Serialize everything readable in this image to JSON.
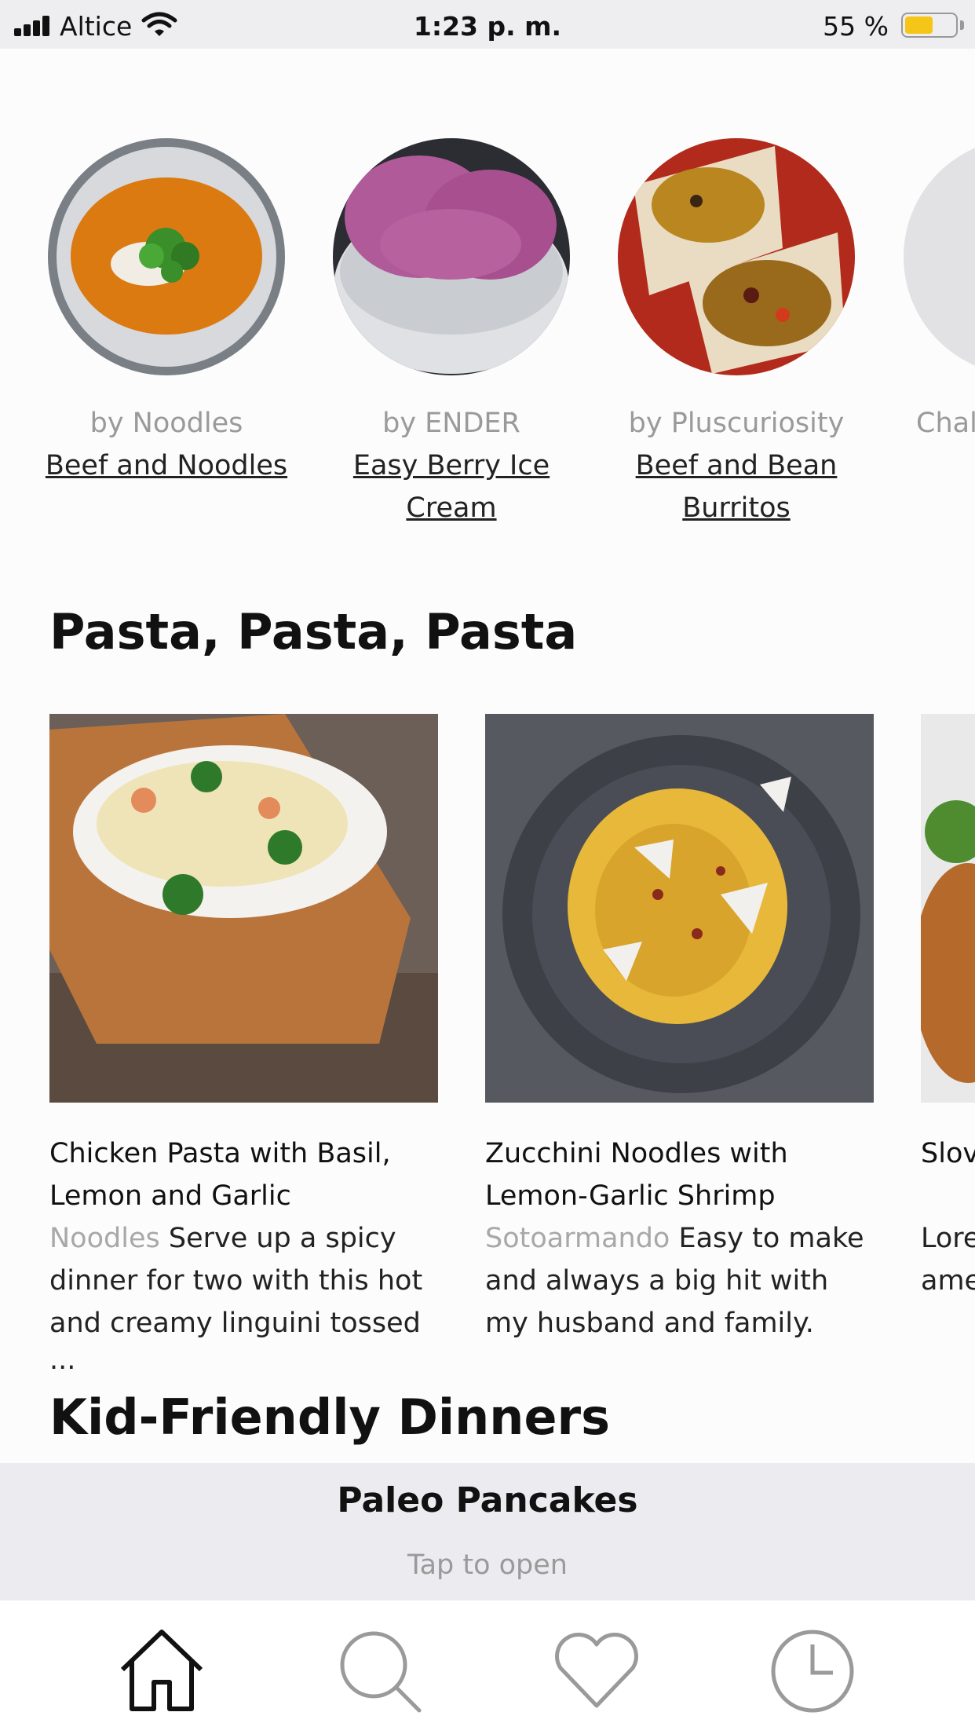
{
  "status_bar": {
    "carrier": "Altice",
    "time": "1:23 p. m.",
    "battery_percent": "55 %",
    "battery_level": 0.55,
    "battery_color": "#f5c518"
  },
  "featured": [
    {
      "author": "by Noodles",
      "title": "Beef and Noodles",
      "image": "soup-bowl"
    },
    {
      "author": "by ENDER",
      "title": "Easy Berry Ice Cream",
      "image": "berry-ice-cream"
    },
    {
      "author": "by Pluscuriosity",
      "title": "Beef and Bean Burritos",
      "image": "burritos"
    },
    {
      "author": "Chal",
      "title": "",
      "image": "placeholder"
    }
  ],
  "sections": {
    "pasta_title": "Pasta, Pasta, Pasta",
    "kids_title": "Kid-Friendly Dinners"
  },
  "pasta_cards": [
    {
      "title": "Chicken Pasta with Basil, Lemon and Garlic",
      "source": "Noodles",
      "description": "Serve up a spicy dinner for two with this hot and creamy linguini tossed",
      "ellipsis": "..."
    },
    {
      "title": "Zucchini Noodles with Lemon-Garlic Shrimp",
      "source": "Sotoarmando",
      "description": "Easy to make and always a big hit with my husband and family."
    },
    {
      "title": "Slov",
      "source": "",
      "description": "Lore ame"
    }
  ],
  "mini_player": {
    "title": "Paleo Pancakes",
    "subtitle": "Tap to open"
  },
  "tab_bar": {
    "items": [
      "home-icon",
      "search-icon",
      "heart-icon",
      "clock-icon"
    ],
    "active_color": "#111111",
    "inactive_color": "#9a9a9a"
  }
}
